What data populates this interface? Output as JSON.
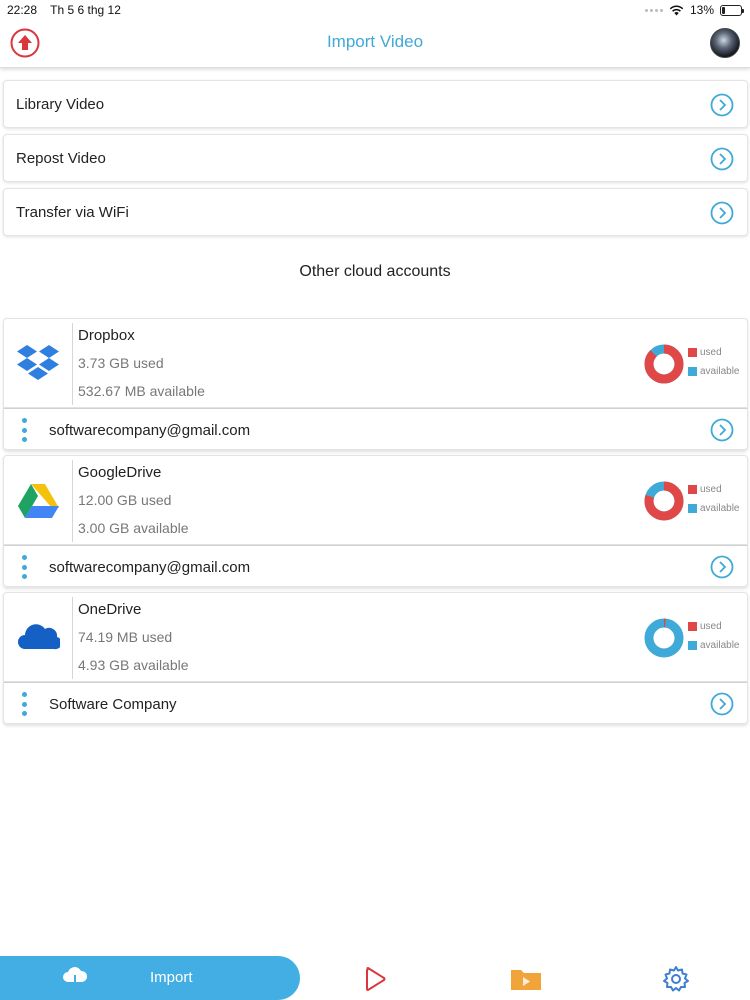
{
  "status_bar": {
    "time": "22:28",
    "date": "Th 5 6 thg 12",
    "battery": "13%"
  },
  "header": {
    "title": "Import Video"
  },
  "options": [
    {
      "label": "Library Video"
    },
    {
      "label": "Repost Video"
    },
    {
      "label": "Transfer via WiFi"
    }
  ],
  "section_title": "Other cloud accounts",
  "legend": {
    "used": "used",
    "available": "available"
  },
  "colors": {
    "accent": "#3fa9d8",
    "used": "#e04848",
    "available": "#3fa9d8"
  },
  "clouds": [
    {
      "name": "Dropbox",
      "used": "3.73 GB used",
      "available": "532.67 MB available",
      "account": "softwarecompany@gmail.com",
      "used_fraction": 0.875,
      "icon": "dropbox-icon"
    },
    {
      "name": "GoogleDrive",
      "used": "12.00 GB used",
      "available": "3.00 GB available",
      "account": "softwarecompany@gmail.com",
      "used_fraction": 0.8,
      "icon": "google-drive-icon"
    },
    {
      "name": "OneDrive",
      "used": "74.19 MB used",
      "available": "4.93 GB available",
      "account": "Software Company",
      "used_fraction": 0.015,
      "icon": "onedrive-icon"
    }
  ],
  "tab_bar": {
    "import_label": "Import"
  }
}
